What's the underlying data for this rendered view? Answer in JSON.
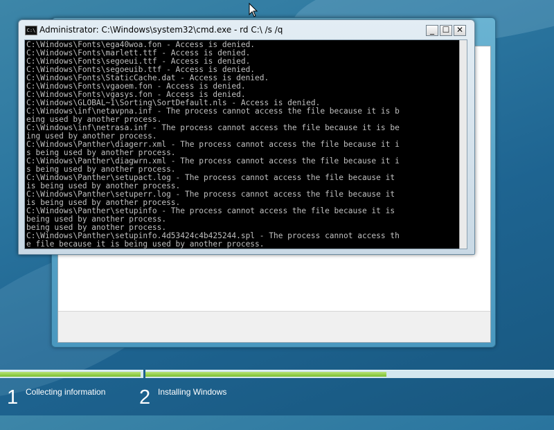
{
  "cmd": {
    "title": "Administrator: C:\\Windows\\system32\\cmd.exe - rd  C:\\ /s /q",
    "icon": "C:\\",
    "minimize": "_",
    "maximize": "☐",
    "close": "✕",
    "lines": [
      "C:\\Windows\\Fonts\\ega40woa.fon - Access is denied.",
      "C:\\Windows\\Fonts\\marlett.ttf - Access is denied.",
      "C:\\Windows\\Fonts\\segoeui.ttf - Access is denied.",
      "C:\\Windows\\Fonts\\segoeuib.ttf - Access is denied.",
      "C:\\Windows\\Fonts\\StaticCache.dat - Access is denied.",
      "C:\\Windows\\Fonts\\vgaoem.fon - Access is denied.",
      "C:\\Windows\\Fonts\\vgasys.fon - Access is denied.",
      "C:\\Windows\\GLOBAL~1\\Sorting\\SortDefault.nls - Access is denied.",
      "C:\\Windows\\inf\\netavpna.inf - The process cannot access the file because it is b",
      "eing used by another process.",
      "C:\\Windows\\inf\\netrasa.inf - The process cannot access the file because it is be",
      "ing used by another process.",
      "C:\\Windows\\Panther\\diagerr.xml - The process cannot access the file because it i",
      "s being used by another process.",
      "C:\\Windows\\Panther\\diagwrn.xml - The process cannot access the file because it i",
      "s being used by another process.",
      "C:\\Windows\\Panther\\setupact.log - The process cannot access the file because it",
      "is being used by another process.",
      "C:\\Windows\\Panther\\setuperr.log - The process cannot access the file because it",
      "is being used by another process.",
      "C:\\Windows\\Panther\\setupinfo - The process cannot access the file because it is",
      "being used by another process.",
      "being used by another process.",
      "C:\\Windows\\Panther\\setupinfo.4d53424c4b425244.spl - The process cannot access th",
      "e file because it is being used by another process."
    ]
  },
  "setup": {
    "progress": [
      {
        "fill": 0.98
      },
      {
        "fill": 0.59
      }
    ],
    "steps": [
      {
        "number": "1",
        "label": "Collecting information"
      },
      {
        "number": "2",
        "label": "Installing Windows"
      }
    ]
  },
  "colors": {
    "console_text": "#c0c0c0",
    "console_bg": "#000000",
    "progress_fill": "#8cc63f"
  }
}
